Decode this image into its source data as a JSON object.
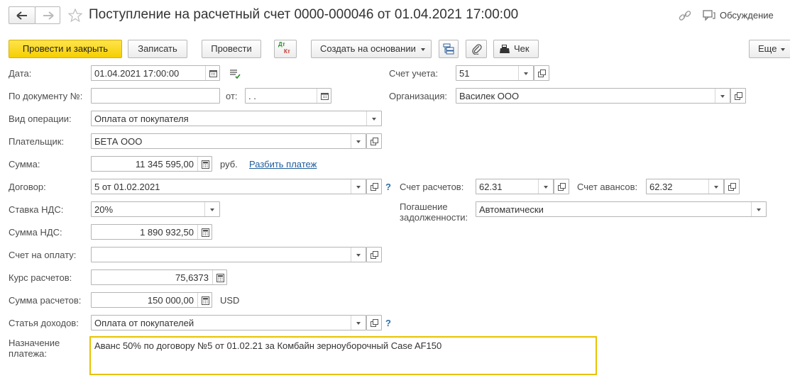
{
  "title": "Поступление на расчетный счет 0000-000046 от 01.04.2021 17:00:00",
  "header": {
    "discussion_label": "Обсуждение"
  },
  "toolbar": {
    "post_close": "Провести и закрыть",
    "save": "Записать",
    "post": "Провести",
    "dtkt_top": "Дт",
    "dtkt_bottom": "Кт",
    "create_based": "Создать на основании",
    "receipt": "Чек",
    "more": "Еще"
  },
  "form": {
    "date_label": "Дата:",
    "date_value": "01.04.2021 17:00:00",
    "doc_num_label": "По документу №:",
    "doc_num_value": "",
    "from_label": "от:",
    "from_value": " .  .",
    "op_type_label": "Вид операции:",
    "op_type_value": "Оплата от покупателя",
    "payer_label": "Плательщик:",
    "payer_value": "БЕТА ООО",
    "amount_label": "Сумма:",
    "amount_value": "11 345 595,00",
    "amount_currency": "руб.",
    "split_link": "Разбить платеж",
    "contract_label": "Договор:",
    "contract_value": "5 от 01.02.2021",
    "vat_rate_label": "Ставка НДС:",
    "vat_rate_value": "20%",
    "vat_amount_label": "Сумма НДС:",
    "vat_amount_value": "1 890 932,50",
    "invoice_label": "Счет на оплату:",
    "invoice_value": "",
    "rate_label": "Курс расчетов:",
    "rate_value": "75,6373",
    "settle_amount_label": "Сумма расчетов:",
    "settle_amount_value": "150 000,00",
    "settle_currency": "USD",
    "income_item_label": "Статья доходов:",
    "income_item_value": "Оплата от покупателей",
    "purpose_label_1": "Назначение",
    "purpose_label_2": "платежа:",
    "purpose_value": "Аванс 50% по договору №5 от 01.02.21 за Комбайн зерноуборочный Case AF150",
    "account_label": "Счет учета:",
    "account_value": "51",
    "org_label": "Организация:",
    "org_value": "Василек ООО",
    "settle_acc_label": "Счет расчетов:",
    "settle_acc_value": "62.31",
    "advance_acc_label": "Счет авансов:",
    "advance_acc_value": "62.32",
    "debt_label_1": "Погашение",
    "debt_label_2": "задолженности:",
    "debt_value": "Автоматически",
    "help_mark": "?"
  },
  "colors": {
    "primary_button": "#f5cf00",
    "link": "#1f5d9c",
    "focus_border": "#e8c200"
  }
}
